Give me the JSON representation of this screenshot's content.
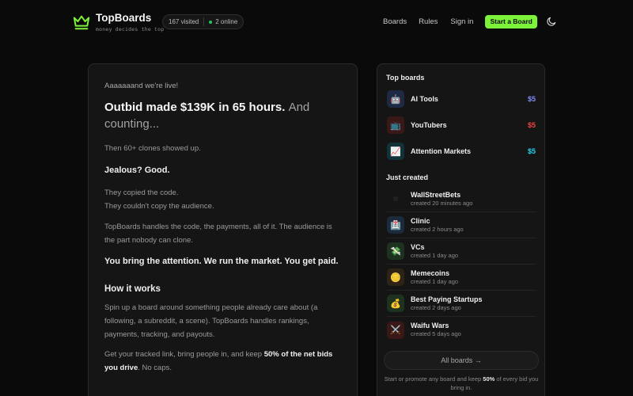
{
  "brand": {
    "name": "TopBoards",
    "tagline": "money decides the top"
  },
  "stats": {
    "visited": "167 visited",
    "online": "2 online"
  },
  "nav": {
    "boards": "Boards",
    "rules": "Rules",
    "signin": "Sign in",
    "start": "Start a Board"
  },
  "colors": {
    "accent": "#7cf23a",
    "online": "#22c55e"
  },
  "article": {
    "intro": "Aaaaaaand we're live!",
    "headline": "Outbid made $139K in 65 hours.",
    "headline_muted": "And counting...",
    "p1": "Then 60+ clones showed up.",
    "jealous": "Jealous? Good.",
    "p2a": "They copied the code.",
    "p2b": "They couldn't copy the audience.",
    "p3": "TopBoards handles the code, the payments, all of it. The audience is the part nobody can clone.",
    "bring": "You bring the attention. We run the market. You get paid.",
    "how_title": "How it works",
    "how_p1": "Spin up a board around something people already care about (a following, a subreddit, a scene). TopBoards handles rankings, payments, tracking, and payouts.",
    "how_p2_pre": "Get your tracked link, bring people in, and keep",
    "how_p2_bold": "50% of the net bids you drive",
    "how_p2_post": ". No caps."
  },
  "sidebar": {
    "top_title": "Top boards",
    "top": [
      {
        "name": "AI Tools",
        "price": "$5",
        "icon": "robot-icon",
        "price_color": "#818cf8"
      },
      {
        "name": "YouTubers",
        "price": "$5",
        "icon": "tv-icon",
        "price_color": "#ef4444"
      },
      {
        "name": "Attention Markets",
        "price": "$5",
        "icon": "chart-icon",
        "price_color": "#22d3ee"
      }
    ],
    "new_title": "Just created",
    "new": [
      {
        "name": "WallStreetBets",
        "time": "created 20 minutes ago",
        "icon": "wsb-icon"
      },
      {
        "name": "Clinic",
        "time": "created 2 hours ago",
        "icon": "hospital-icon"
      },
      {
        "name": "VCs",
        "time": "created 1 day ago",
        "icon": "money-icon"
      },
      {
        "name": "Memecoins",
        "time": "created 1 day ago",
        "icon": "coin-icon"
      },
      {
        "name": "Best Paying Startups",
        "time": "created 2 days ago",
        "icon": "moneybag-icon"
      },
      {
        "name": "Waifu Wars",
        "time": "created 5 days ago",
        "icon": "swords-icon"
      }
    ],
    "all_boards": "All boards →",
    "footer_pre": "Start or promote any board and keep",
    "footer_bold": "50%",
    "footer_post": "of every bid you bring in."
  }
}
